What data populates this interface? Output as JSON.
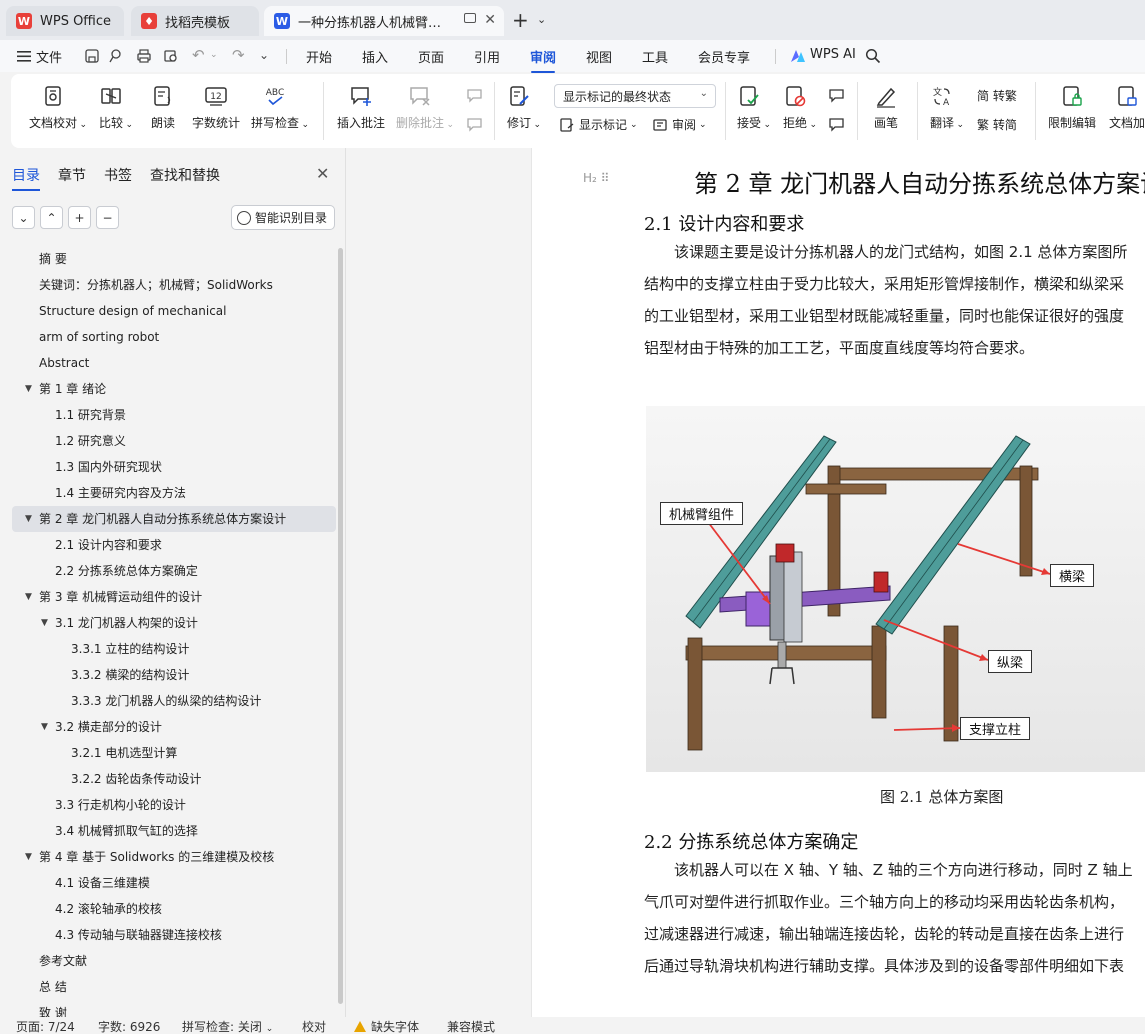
{
  "tabs": [
    {
      "label": "WPS Office",
      "icon": "wps-logo-icon",
      "color": "#e8403a"
    },
    {
      "label": "找稻壳模板",
      "icon": "docer-icon",
      "color": "#e8403a"
    },
    {
      "label": "一种分拣机器人机械臂结构设计",
      "icon": "writer-doc-icon",
      "color": "#2b5ce6"
    }
  ],
  "menubar": {
    "file": "文件",
    "items": [
      "开始",
      "插入",
      "页面",
      "引用",
      "审阅",
      "视图",
      "工具",
      "会员专享"
    ],
    "active": "审阅",
    "ai": "WPS AI"
  },
  "ribbon": {
    "doc_check": "文档校对",
    "compare": "比较",
    "read_aloud": "朗读",
    "word_count": "字数统计",
    "spell_check": "拼写检查",
    "insert_comment": "插入批注",
    "delete_comment": "删除批注",
    "track_changes": "修订",
    "markup_select": "显示标记的最终状态",
    "show_markup": "显示标记",
    "review": "审阅",
    "accept": "接受",
    "reject": "拒绝",
    "pen": "画笔",
    "translate": "翻译",
    "to_traditional": "简 转繁",
    "to_simplified": "繁 转简",
    "restrict_edit": "限制编辑",
    "doc_encrypt": "文档加"
  },
  "nav": {
    "tabs": [
      "目录",
      "章节",
      "书签",
      "查找和替换"
    ],
    "active_tab": "目录",
    "smart_toc": "智能识别目录",
    "items": [
      {
        "text": "摘  要",
        "level": 0,
        "arrow": false
      },
      {
        "text": "关键词：分拣机器人；机械臂；SolidWorks",
        "level": 0,
        "arrow": false
      },
      {
        "text": "Structure design of mechanical",
        "level": 0,
        "arrow": false
      },
      {
        "text": "arm of sorting robot",
        "level": 0,
        "arrow": false
      },
      {
        "text": "Abstract",
        "level": 0,
        "arrow": false
      },
      {
        "text": "第 1 章  绪论",
        "level": 0,
        "arrow": true
      },
      {
        "text": "1.1  研究背景",
        "level": 1,
        "arrow": false
      },
      {
        "text": "1.2  研究意义",
        "level": 1,
        "arrow": false
      },
      {
        "text": "1.3  国内外研究现状",
        "level": 1,
        "arrow": false
      },
      {
        "text": "1.4  主要研究内容及方法",
        "level": 1,
        "arrow": false
      },
      {
        "text": "第 2 章  龙门机器人自动分拣系统总体方案设计",
        "level": 0,
        "arrow": true,
        "selected": true
      },
      {
        "text": "2.1 设计内容和要求",
        "level": 1,
        "arrow": false
      },
      {
        "text": "2.2 分拣系统总体方案确定",
        "level": 1,
        "arrow": false
      },
      {
        "text": "第 3 章  机械臂运动组件的设计",
        "level": 0,
        "arrow": true
      },
      {
        "text": "3.1 龙门机器人构架的设计",
        "level": 1,
        "arrow": true
      },
      {
        "text": "3.3.1 立柱的结构设计",
        "level": 2,
        "arrow": false
      },
      {
        "text": "3.3.2 横梁的结构设计",
        "level": 2,
        "arrow": false
      },
      {
        "text": "3.3.3 龙门机器人的纵梁的结构设计",
        "level": 2,
        "arrow": false
      },
      {
        "text": "3.2  横走部分的设计",
        "level": 1,
        "arrow": true
      },
      {
        "text": "3.2.1 电机选型计算",
        "level": 2,
        "arrow": false
      },
      {
        "text": "3.2.2 齿轮齿条传动设计",
        "level": 2,
        "arrow": false
      },
      {
        "text": "3.3  行走机构小轮的设计",
        "level": 1,
        "arrow": false
      },
      {
        "text": "3.4  机械臂抓取气缸的选择",
        "level": 1,
        "arrow": false
      },
      {
        "text": "第 4 章  基于 Solidworks 的三维建模及校核",
        "level": 0,
        "arrow": true
      },
      {
        "text": "4.1  设备三维建模",
        "level": 1,
        "arrow": false
      },
      {
        "text": "4.2  滚轮轴承的校核",
        "level": 1,
        "arrow": false
      },
      {
        "text": "4.3 传动轴与联轴器键连接校核",
        "level": 1,
        "arrow": false
      },
      {
        "text": "参考文献",
        "level": 0,
        "arrow": false
      },
      {
        "text": "总  结",
        "level": 0,
        "arrow": false
      },
      {
        "text": "致  谢",
        "level": 0,
        "arrow": false
      }
    ]
  },
  "doc": {
    "heading_marker": "H₂",
    "chapter_title": "第 2 章  龙门机器人自动分拣系统总体方案设",
    "sec1_title": "2.1 设计内容和要求",
    "para1": [
      "该课题主要是设计分拣机器人的龙门式结构，如图 2.1 总体方案图所",
      "结构中的支撑立柱由于受力比较大，采用矩形管焊接制作，横梁和纵梁采",
      "的工业铝型材，采用工业铝型材既能减轻重量，同时也能保证很好的强度",
      "铝型材由于特殊的加工工艺，平面度直线度等均符合要求。"
    ],
    "callouts": {
      "arm": "机械臂组件",
      "crossbeam": "横梁",
      "longbeam": "纵梁",
      "column": "支撑立柱"
    },
    "figure_caption": "图 2.1  总体方案图",
    "sec2_title": "2.2 分拣系统总体方案确定",
    "para2": [
      "该机器人可以在 X 轴、Y 轴、Z 轴的三个方向进行移动，同时 Z 轴上",
      "气爪可对塑件进行抓取作业。三个轴方向上的移动均采用齿轮齿条机构，",
      "过减速器进行减速，输出轴端连接齿轮，齿轮的转动是直接在齿条上进行",
      "后通过导轨滑块机构进行辅助支撑。具体涉及到的设备零部件明细如下表"
    ]
  },
  "status": {
    "page": "页面: 7/24",
    "words": "字数: 6926",
    "spell": "拼写检查: 关闭",
    "proof": "校对",
    "missing_font": "缺失字体",
    "compat": "兼容模式"
  },
  "colors": {
    "accent": "#1e56d8",
    "beam_teal": "#4e9d9a",
    "frame_brown": "#7a5636",
    "callout_arrow": "#e53935"
  }
}
